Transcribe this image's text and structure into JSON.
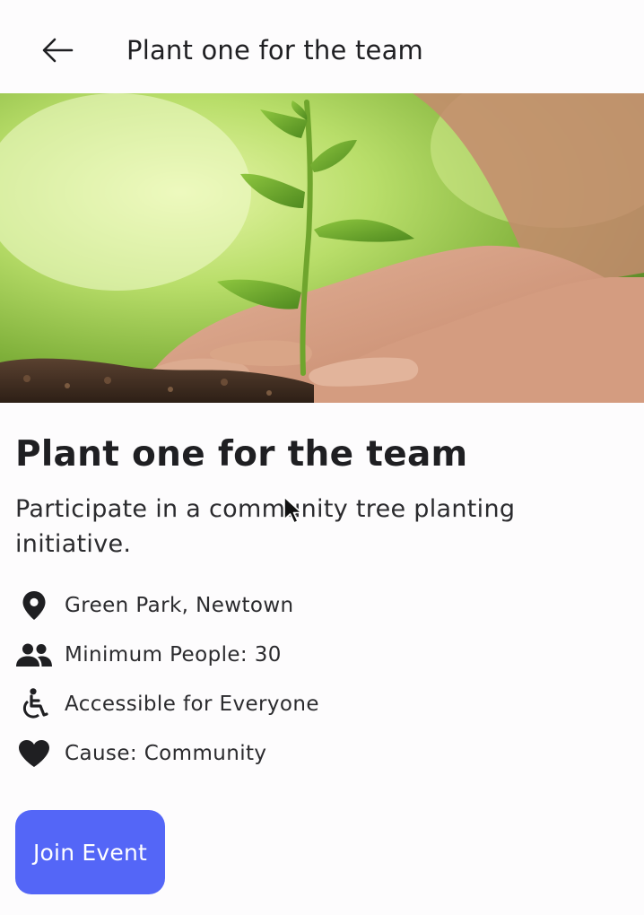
{
  "header": {
    "back_icon": "arrow-left-icon",
    "title": "Plant one for the team"
  },
  "hero": {
    "image_subject": "seedling-in-soil-with-hands"
  },
  "event": {
    "title": "Plant one for the team",
    "description": "Participate in a community tree planting initiative.",
    "details": [
      {
        "icon": "location-pin-icon",
        "text": "Green Park, Newtown"
      },
      {
        "icon": "people-icon",
        "text": "Minimum People: 30"
      },
      {
        "icon": "accessible-icon",
        "text": "Accessible for Everyone"
      },
      {
        "icon": "heart-icon",
        "text": "Cause: Community"
      }
    ]
  },
  "actions": {
    "join_label": "Join Event"
  },
  "colors": {
    "accent": "#5466f7",
    "background": "#fdfcfd",
    "text": "#1f1f22"
  }
}
